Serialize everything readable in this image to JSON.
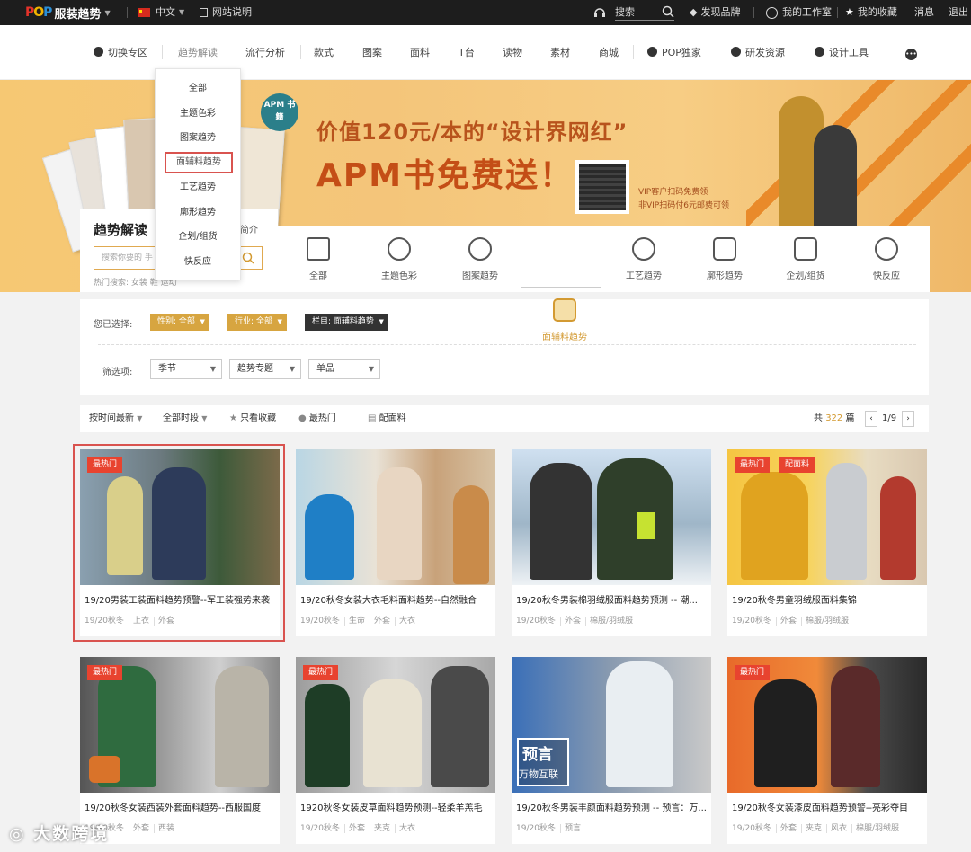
{
  "topbar": {
    "brand": "服装趋势",
    "language": "中文",
    "site_guide": "网站说明",
    "search_label": "搜索",
    "discover_brands": "发现品牌",
    "my_workspace": "我的工作室",
    "my_favorites": "我的收藏",
    "messages": "消息",
    "logout": "退出"
  },
  "nav": {
    "items": [
      "切换专区",
      "趋势解读",
      "流行分析",
      "款式",
      "图案",
      "面料",
      "T台",
      "读物",
      "素材",
      "商城",
      "POP独家",
      "研发资源",
      "设计工具"
    ]
  },
  "banner": {
    "badge": "APM 书籍",
    "line1": "价值120元/本的“设计界网红”",
    "line2": "APM书免费送！",
    "note1": "VIP客户扫码免费领",
    "note2": "非VIP扫码付6元邮费可领"
  },
  "dropdown": {
    "items": [
      "全部",
      "主题色彩",
      "图案趋势",
      "面辅料趋势",
      "工艺趋势",
      "廓形趋势",
      "企划/组货",
      "快反应"
    ]
  },
  "sidebar": {
    "title": "趋势解读",
    "intro": "简介",
    "search_placeholder": "搜索你要的 手",
    "hot": "热门搜索: 女装 鞋 运动"
  },
  "categories": {
    "items": [
      "全部",
      "主题色彩",
      "图案趋势",
      "面辅料趋势",
      "工艺趋势",
      "廓形趋势",
      "企划/组货",
      "快反应"
    ],
    "selected": "面辅料趋势"
  },
  "filter": {
    "selected_label": "您已选择:",
    "tags": [
      "性别: 全部",
      "行业: 全部",
      "栏目: 面辅料趋势"
    ],
    "filter_label": "筛选项:",
    "selects": [
      "季节",
      "趋势专题",
      "单品"
    ]
  },
  "sortbar": {
    "sort": "按时间最新",
    "period": "全部时段",
    "only_fav": "只看收藏",
    "hottest": "最热门",
    "fabric": "配面料",
    "total_prefix": "共",
    "total": "322",
    "total_suffix": "篇",
    "page": "1/9",
    "prev": "‹",
    "next": "›"
  },
  "cards": [
    {
      "badge": "最热门",
      "title": "19/20男装工装面料趋势预警--军工装强势来袭",
      "tags": [
        "19/20秋冬",
        "上衣",
        "外套"
      ]
    },
    {
      "badge": "",
      "title": "19/20秋冬女装大衣毛料面料趋势--自然融合",
      "tags": [
        "19/20秋冬",
        "生命",
        "外套",
        "大衣"
      ]
    },
    {
      "badge": "",
      "title": "19/20秋冬男装棉羽绒服面料趋势预测 -- 潮...",
      "tags": [
        "19/20秋冬",
        "外套",
        "棉服/羽绒服"
      ]
    },
    {
      "badge": "最热门",
      "badge2": "配面料",
      "title": "19/20秋冬男童羽绒服面料集锦",
      "tags": [
        "19/20秋冬",
        "外套",
        "棉服/羽绒服"
      ]
    },
    {
      "badge": "最热门",
      "title": "19/20秋冬女装西装外套面料趋势--西服国度",
      "tags": [
        "19/20秋冬",
        "外套",
        "西装"
      ]
    },
    {
      "badge": "最热门",
      "title": "1920秋冬女装皮草面料趋势预测--轻柔羊羔毛",
      "tags": [
        "19/20秋冬",
        "外套",
        "夹克",
        "大衣"
      ]
    },
    {
      "badge": "",
      "title": "19/20秋冬男装丰颜面料趋势预测 -- 预言：万...",
      "tags": [
        "19/20秋冬",
        "预言"
      ]
    },
    {
      "badge": "最热门",
      "title": "19/20秋冬女装漆皮面料趋势预警--亮彩夺目",
      "tags": [
        "19/20秋冬",
        "外套",
        "夹克",
        "风衣",
        "棉服/羽绒服"
      ]
    }
  ],
  "card_overlay": {
    "line1": "预言",
    "line2": "万物互联"
  },
  "watermark": "大数跨境",
  "colors": {
    "accent": "#d7a540",
    "badge": "#e8432f",
    "highlight": "#d9534f",
    "topbar": "#1d1d1d"
  }
}
